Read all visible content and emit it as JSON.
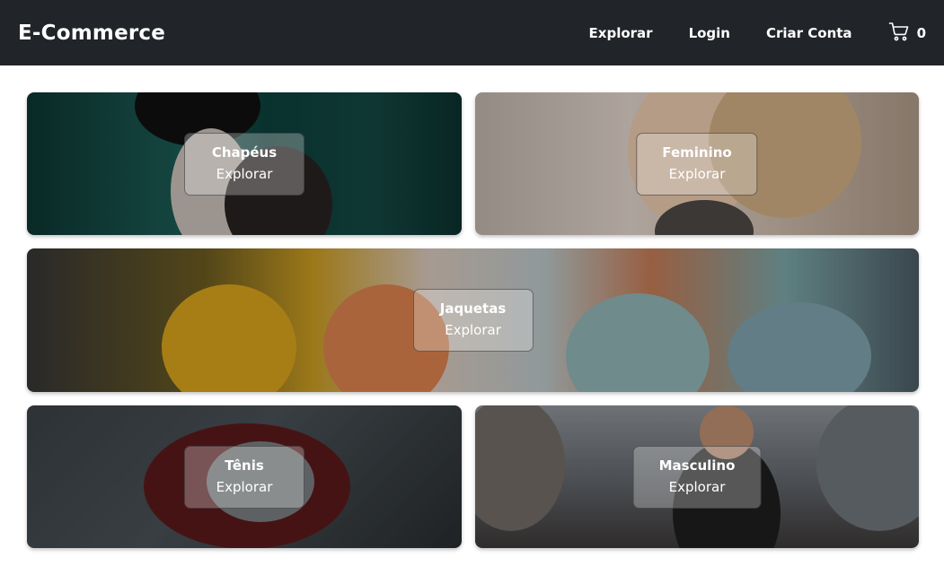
{
  "header": {
    "brand": "E-Commerce",
    "nav": {
      "explore": "Explorar",
      "login": "Login",
      "signup": "Criar Conta"
    },
    "cart": {
      "icon": "shopping-cart-icon",
      "count": "0"
    }
  },
  "categories": [
    {
      "title": "Chapéus",
      "action": "Explorar"
    },
    {
      "title": "Feminino",
      "action": "Explorar"
    },
    {
      "title": "Jaquetas",
      "action": "Explorar"
    },
    {
      "title": "Tênis",
      "action": "Explorar"
    },
    {
      "title": "Masculino",
      "action": "Explorar"
    }
  ],
  "colors": {
    "header_bg": "#212428",
    "page_bg": "#ffffff",
    "text_on_dark": "#ffffff"
  }
}
